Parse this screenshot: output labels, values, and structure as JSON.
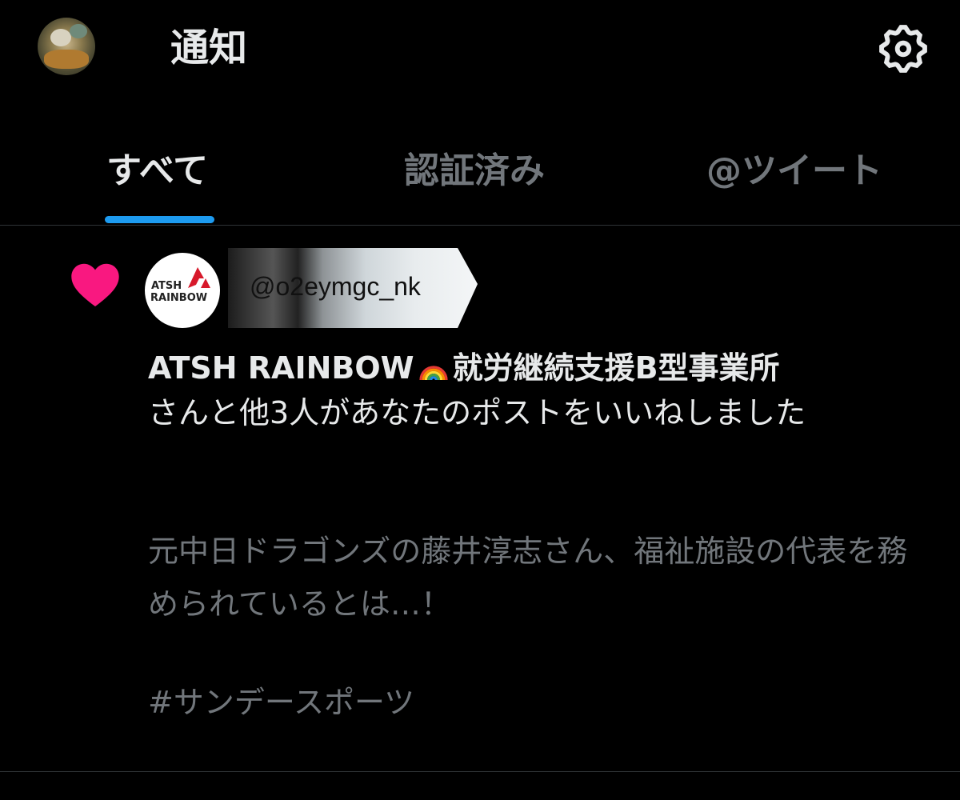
{
  "header": {
    "title": "通知",
    "avatar_icon": "user-avatar",
    "settings_icon": "gear-icon"
  },
  "tabs": [
    {
      "label": "すべて",
      "active": true
    },
    {
      "label": "認証済み",
      "active": false
    },
    {
      "label": "@ツイート",
      "active": false
    }
  ],
  "colors": {
    "background": "#000000",
    "primary_text": "#e7e9ea",
    "secondary_text": "#71767b",
    "accent": "#1d9bf0",
    "like": "#f91880",
    "divider": "#2f3336"
  },
  "notification": {
    "type_icon": "heart-icon",
    "actor_avatar": {
      "logo_line1": "ATSH",
      "logo_line2": "RAINBOW"
    },
    "actor_handle": "@o2eymgc_nk",
    "actor_name_prefix": "ATSH RAINBOW",
    "actor_name_emoji": "rainbow-emoji",
    "actor_name_suffix": "就労継続支援B型事業所",
    "action_text": "さんと他3人があなたのポストをいいねしました",
    "post_excerpt": "元中日ドラゴンズの藤井淳志さん、福祉施設の代表を務められているとは…！",
    "post_hashtag": "#サンデースポーツ"
  }
}
